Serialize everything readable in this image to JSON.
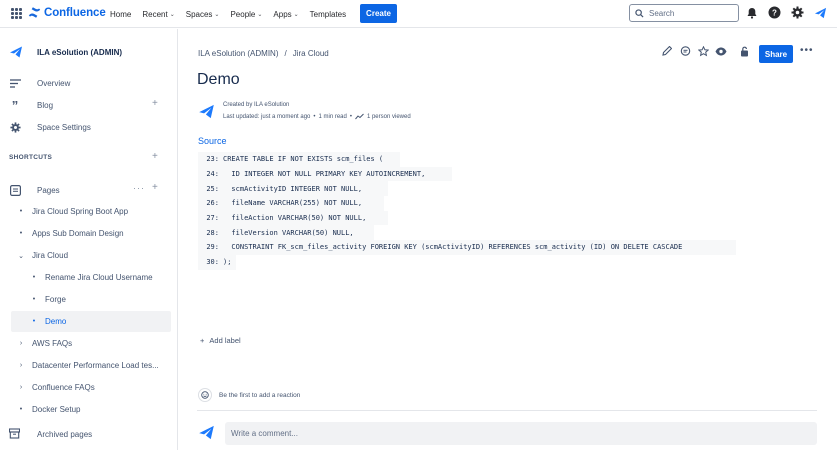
{
  "topnav": {
    "logo_text": "Confluence",
    "links": [
      "Home",
      "Recent",
      "Spaces",
      "People",
      "Apps",
      "Templates"
    ],
    "create_label": "Create",
    "search_placeholder": "Search"
  },
  "sidebar": {
    "space_name": "ILA eSolution (ADMIN)",
    "overview": "Overview",
    "blog": "Blog",
    "space_settings": "Space Settings",
    "shortcuts": "SHORTCUTS",
    "pages": "Pages",
    "tree": [
      {
        "label": "Jira Cloud Spring Boot App",
        "marker": "•"
      },
      {
        "label": "Apps Sub Domain Design",
        "marker": "•"
      },
      {
        "label": "Jira Cloud",
        "marker": "⌄"
      },
      {
        "label": "Rename Jira Cloud Username",
        "marker": "•"
      },
      {
        "label": "Forge",
        "marker": "•"
      },
      {
        "label": "Demo",
        "marker": "•"
      },
      {
        "label": "AWS FAQs",
        "marker": "›"
      },
      {
        "label": "Datacenter Performance Load tes...",
        "marker": "›"
      },
      {
        "label": "Confluence FAQs",
        "marker": "›"
      },
      {
        "label": "Docker Setup",
        "marker": "•"
      }
    ],
    "archived": "Archived pages"
  },
  "breadcrumb": {
    "space": "ILA eSolution (ADMIN)",
    "sep": "/",
    "parent": "Jira Cloud"
  },
  "share_label": "Share",
  "page": {
    "title": "Demo",
    "created_by": "Created by ILA eSolution",
    "updated": "Last updated: just a moment ago",
    "read_time": "1 min read",
    "viewed": "1 person viewed",
    "source_heading": "Source",
    "code": [
      {
        "ln": "23:",
        "text": "CREATE TABLE IF NOT EXISTS scm_files ("
      },
      {
        "ln": "24:",
        "text": "  ID INTEGER NOT NULL PRIMARY KEY AUTOINCREMENT,"
      },
      {
        "ln": "25:",
        "text": "  scmActivityID INTEGER NOT NULL,"
      },
      {
        "ln": "26:",
        "text": "  fileName VARCHAR(255) NOT NULL,"
      },
      {
        "ln": "27:",
        "text": "  fileAction VARCHAR(50) NOT NULL,"
      },
      {
        "ln": "28:",
        "text": "  fileVersion VARCHAR(50) NULL,"
      },
      {
        "ln": "29:",
        "text": "  CONSTRAINT FK_scm_files_activity FOREIGN KEY (scmActivityID) REFERENCES scm_activity (ID) ON DELETE CASCADE"
      },
      {
        "ln": "30:",
        "text": ");"
      }
    ],
    "add_label": "Add label",
    "reaction_text": "Be the first to add a reaction",
    "comment_placeholder": "Write a comment..."
  },
  "colors": {
    "brand": "#0c66e4",
    "text": "#172b4d",
    "subtle": "#44546f"
  }
}
